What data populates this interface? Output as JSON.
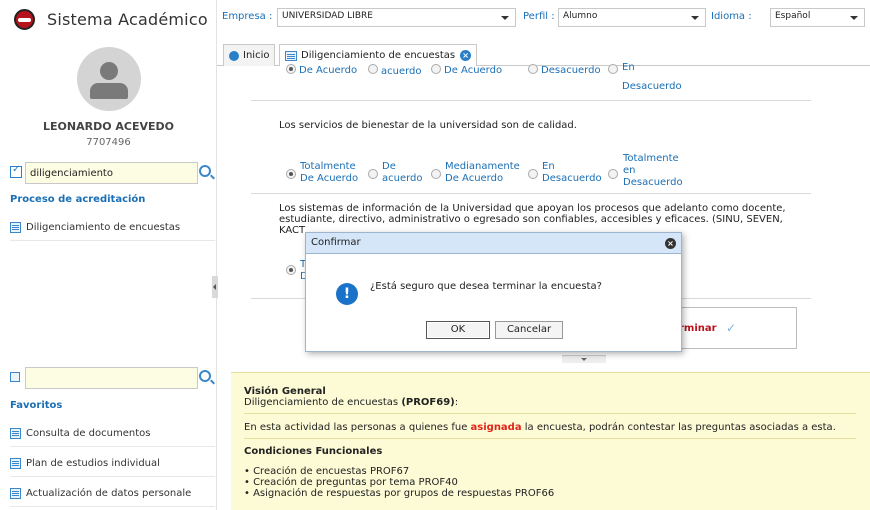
{
  "app": {
    "title": "Sistema Académico"
  },
  "user": {
    "name": "LEONARDO ACEVEDO",
    "id": "7707496"
  },
  "sidebar": {
    "search_value": "diligenciamiento",
    "section1_heading": "Proceso de acreditación",
    "section1_items": [
      {
        "label": "Diligenciamiento de encuestas",
        "icon": "list-icon"
      }
    ],
    "search2_value": "",
    "favorites_heading": "Favoritos",
    "favorites": [
      {
        "label": "Consulta de documentos",
        "icon": "table-icon"
      },
      {
        "label": "Plan de estudios individual",
        "icon": "document-icon"
      },
      {
        "label": "Actualización de datos personale",
        "icon": "list-icon"
      }
    ]
  },
  "topbar": {
    "empresa_label": "Empresa :",
    "empresa_value": "UNIVERSIDAD LIBRE",
    "perfil_label": "Perfil :",
    "perfil_value": "Alumno",
    "idioma_label": "Idioma :",
    "idioma_value": "Español"
  },
  "tabs": [
    {
      "label": "Inicio",
      "icon": "circle-icon"
    },
    {
      "label": "Diligenciamiento de encuestas",
      "icon": "list-icon",
      "closable": true
    }
  ],
  "survey": {
    "partial_options": {
      "opt1": "De Acuerdo",
      "opt2": "acuerdo",
      "opt3": "De Acuerdo",
      "opt4": "Desacuerdo",
      "opt5a": "En",
      "opt5b": "Desacuerdo"
    },
    "q1": {
      "text": "Los servicios de bienestar de la universidad son de calidad.",
      "o1a": "Totalmente",
      "o1b": "De Acuerdo",
      "o2a": "De",
      "o2b": "acuerdo",
      "o3a": "Medianamente",
      "o3b": "De Acuerdo",
      "o4a": "En",
      "o4b": "Desacuerdo",
      "o5a": "Totalmente",
      "o5b": "en",
      "o5c": "Desacuerdo"
    },
    "q2": {
      "line1": "Los sistemas de información de la Universidad que apoyan los procesos que adelanto como docente,",
      "line2": "estudiante, directivo, administrativo o egresado son confiables, accesibles y eficaces. (SINU, SEVEN,",
      "line3": "KACT",
      "opt_partial_a": "T",
      "opt_partial_b": "D"
    },
    "finish_label": "rminar"
  },
  "dialog": {
    "title": "Confirmar",
    "message": "¿Está seguro que desea terminar la encuesta?",
    "ok": "OK",
    "cancel": "Cancelar"
  },
  "info": {
    "heading": "Visión General",
    "sub_prefix": "Diligenciamiento de encuestas ",
    "sub_code": "(PROF69)",
    "sub_suffix": ":",
    "desc_prefix": "En esta actividad las personas a quienes fue ",
    "desc_highlight": "asignada",
    "desc_suffix": " la encuesta, podrán contestar las preguntas asociadas a esta.",
    "conditions_heading": "Condiciones Funcionales",
    "conditions": [
      "• Creación de encuestas PROF67",
      "• Creación de preguntas por tema PROF40",
      "• Asignación de respuestas por grupos de respuestas PROF66"
    ]
  },
  "colors": {
    "accent": "#1b6fb5",
    "brand": "#b5121b",
    "info_bg": "#fdfbd6",
    "highlight": "#e0261a"
  }
}
